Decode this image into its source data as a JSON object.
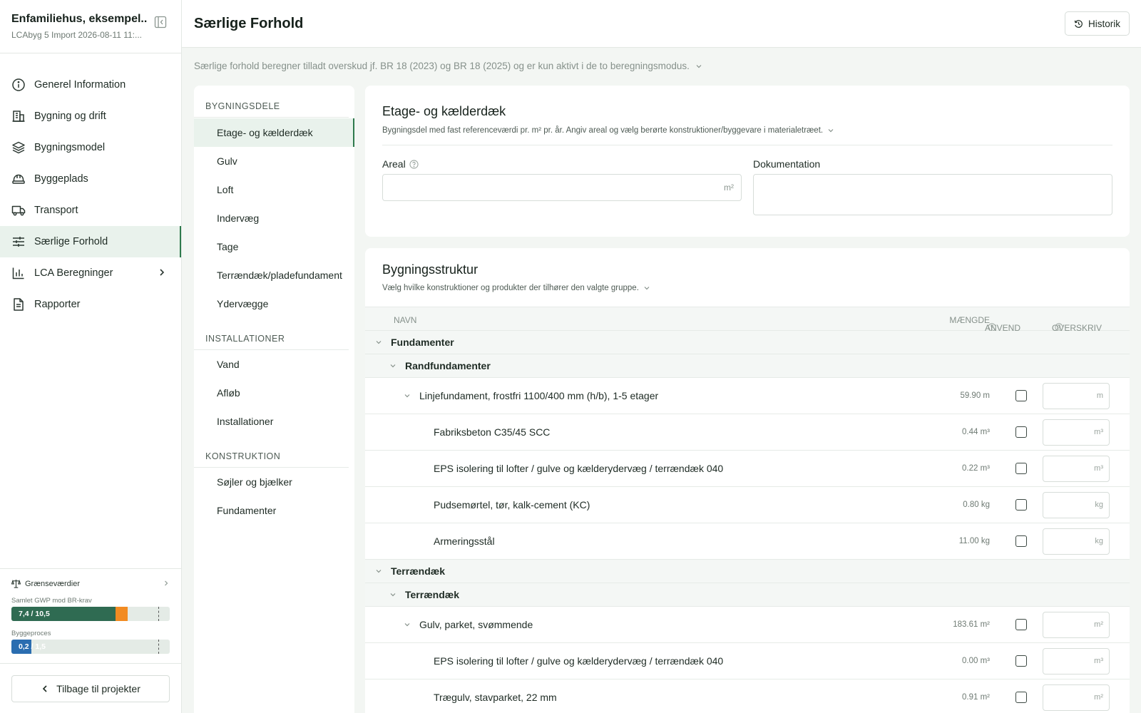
{
  "sidebar": {
    "project_title": "Enfamiliehus, eksempel...",
    "project_subtitle": "LCAbyg 5 Import 2026-08-11 11:...",
    "nav": [
      {
        "label": "Generel Information",
        "icon": "info-icon"
      },
      {
        "label": "Bygning og drift",
        "icon": "building-icon"
      },
      {
        "label": "Bygningsmodel",
        "icon": "layers-icon"
      },
      {
        "label": "Byggeplads",
        "icon": "helmet-icon"
      },
      {
        "label": "Transport",
        "icon": "truck-icon"
      },
      {
        "label": "Særlige Forhold",
        "icon": "sliders-icon",
        "active": true
      },
      {
        "label": "LCA Beregninger",
        "icon": "bar-chart-icon",
        "has_submenu": true
      },
      {
        "label": "Rapporter",
        "icon": "report-icon"
      }
    ],
    "limits": {
      "title": "Grænseværdier",
      "bars": [
        {
          "label": "Samlet GWP mod BR-krav",
          "value_text": "7,4 / 10,5",
          "value": 7.4,
          "max": 10.5,
          "color": "#2f6b52",
          "overflow_color": "#f28b22"
        },
        {
          "label": "Byggeproces",
          "value_text": "0,2 / 1,5",
          "value": 0.2,
          "max": 1.5,
          "color": "#2a6db0"
        }
      ]
    },
    "back_label": "Tilbage til projekter"
  },
  "header": {
    "title": "Særlige Forhold",
    "history_label": "Historik"
  },
  "notice": "Særlige forhold beregner tilladt overskud jf. BR 18 (2023) og BR 18 (2025) og er kun aktivt i de to beregningsmodus.",
  "categories": [
    {
      "heading": "BYGNINGSDELE",
      "items": [
        "Etage- og kælderdæk",
        "Gulv",
        "Loft",
        "Indervæg",
        "Tage",
        "Terrændæk/pladefundament",
        "Ydervægge"
      ]
    },
    {
      "heading": "INSTALLATIONER",
      "items": [
        "Vand",
        "Afløb",
        "Installationer"
      ]
    },
    {
      "heading": "KONSTRUKTION",
      "items": [
        "Søjler og bjælker",
        "Fundamenter"
      ]
    }
  ],
  "active_category": "Etage- og kælderdæk",
  "detail": {
    "title": "Etage- og kælderdæk",
    "subtitle": "Bygningsdel med fast referenceværdi pr. m² pr. år. Angiv areal og vælg berørte konstruktioner/byggevare i materialetræet.",
    "areal_label": "Areal",
    "areal_unit": "m²",
    "areal_value": "",
    "doc_label": "Dokumentation",
    "doc_value": ""
  },
  "structure": {
    "title": "Bygningsstruktur",
    "subtitle": "Vælg hvilke konstruktioner og produkter der tilhører den valgte gruppe.",
    "columns": {
      "name": "NAVN",
      "qty": "MÆNGDE",
      "apply": "ANVEND",
      "override": "OVERSKRIV"
    },
    "rows": [
      {
        "type": "grp",
        "name": "Fundamenter"
      },
      {
        "type": "sub",
        "name": "Randfundamenter"
      },
      {
        "type": "itm",
        "level": 3,
        "name": "Linjefundament, frostfri 1100/400 mm (h/b), 1-5 etager",
        "qty": "59.90 m",
        "unit": "m",
        "checked": false
      },
      {
        "type": "itm",
        "level": 4,
        "name": "Fabriksbeton C35/45 SCC",
        "qty": "0.44 m³",
        "unit": "m³",
        "checked": false
      },
      {
        "type": "itm",
        "level": 4,
        "name": "EPS isolering til lofter / gulve og kælderydervæg / terrændæk 040",
        "qty": "0.22 m³",
        "unit": "m³",
        "checked": false
      },
      {
        "type": "itm",
        "level": 4,
        "name": "Pudsemørtel, tør, kalk-cement (KC)",
        "qty": "0.80 kg",
        "unit": "kg",
        "checked": false
      },
      {
        "type": "itm",
        "level": 4,
        "name": "Armeringsstål",
        "qty": "11.00 kg",
        "unit": "kg",
        "checked": false
      },
      {
        "type": "grp",
        "name": "Terrændæk"
      },
      {
        "type": "sub",
        "name": "Terrændæk"
      },
      {
        "type": "itm",
        "level": 3,
        "name": "Gulv, parket, svømmende",
        "qty": "183.61 m²",
        "unit": "m²",
        "checked": false
      },
      {
        "type": "itm",
        "level": 4,
        "name": "EPS isolering til lofter / gulve og kælderydervæg / terrændæk 040",
        "qty": "0.00 m³",
        "unit": "m³",
        "checked": false
      },
      {
        "type": "itm",
        "level": 4,
        "name": "Trægulv, stavparket, 22 mm",
        "qty": "0.91 m²",
        "unit": "m²",
        "checked": false
      }
    ]
  }
}
